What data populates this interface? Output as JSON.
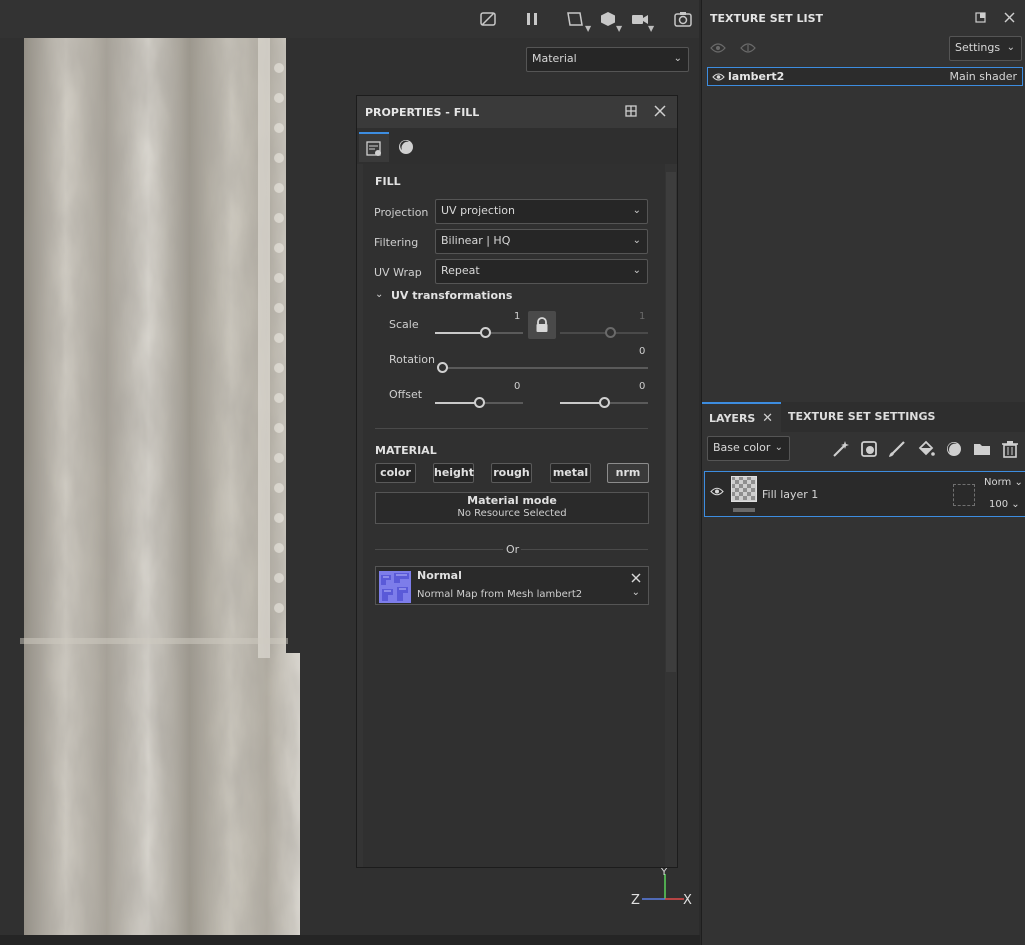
{
  "viewport": {
    "toolbar_icons": [
      "hide-icon",
      "pause-icon",
      "frame-icon",
      "cube-icon",
      "camera-icon",
      "screenshot-icon"
    ],
    "display_mode": "Material",
    "axis_labels": {
      "y": "Y",
      "z": "Z",
      "x": "X"
    }
  },
  "properties": {
    "title": "PROPERTIES - FILL",
    "tabs": [
      "fill-settings-icon",
      "material-sphere-icon"
    ],
    "fill": {
      "section_title": "FILL",
      "projection_label": "Projection",
      "projection_value": "UV projection",
      "filtering_label": "Filtering",
      "filtering_value": "Bilinear | HQ",
      "uvwrap_label": "UV Wrap",
      "uvwrap_value": "Repeat",
      "uv_transformations_label": "UV transformations",
      "scale_label": "Scale",
      "scale_value_u": "1",
      "scale_value_v": "1",
      "scale_u_level": 0.57,
      "scale_v_level": 0.57,
      "rotation_label": "Rotation",
      "rotation_value": "0",
      "rotation_level": 0.0,
      "offset_label": "Offset",
      "offset_value_u": "0",
      "offset_value_v": "0",
      "offset_u_level": 0.5,
      "offset_v_level": 0.5
    },
    "material": {
      "section_title": "MATERIAL",
      "channels": [
        "color",
        "height",
        "rough",
        "metal",
        "nrm"
      ],
      "active_channel": "nrm",
      "mode_title": "Material mode",
      "mode_subtitle": "No Resource Selected",
      "or_label": "Or",
      "resource_title": "Normal",
      "resource_subtitle": "Normal Map from Mesh lambert2"
    }
  },
  "texture_set_list": {
    "title": "TEXTURE SET LIST",
    "settings_label": "Settings",
    "item_name": "lambert2",
    "item_shader": "Main shader"
  },
  "layers": {
    "tab_layers": "LAYERS",
    "tab_texture_set_settings": "TEXTURE SET SETTINGS",
    "channel_select": "Base color",
    "tool_icons": [
      "magic-wand-icon",
      "mask-icon",
      "brush-icon",
      "fill-bucket-icon",
      "smart-material-icon",
      "folder-icon",
      "trash-icon"
    ],
    "layer_name": "Fill layer 1",
    "blend_mode": "Norm",
    "opacity": "100"
  }
}
